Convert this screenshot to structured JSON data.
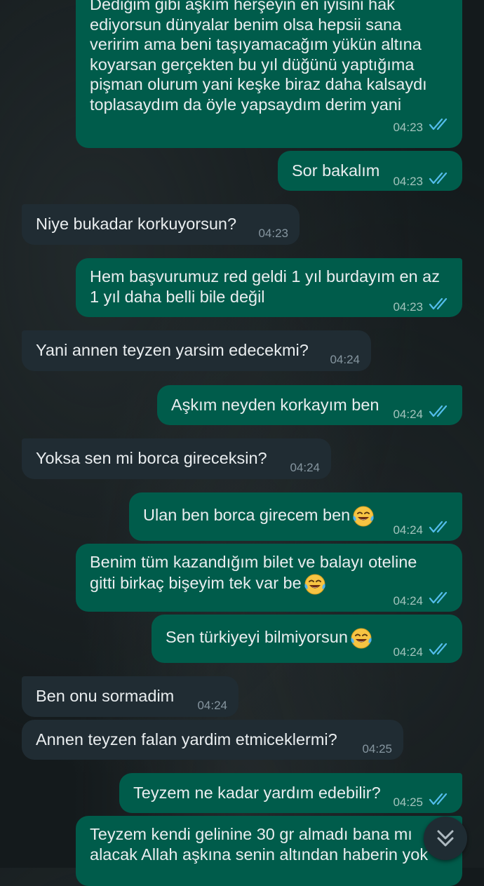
{
  "messages": [
    {
      "dir": "out",
      "text": "Dediğim gibi aşkım herşeyin en iyisini hak\nediyorsun dünyalar benim olsa hepsii sana\nveririm ama beni taşıyamacağım yükün altına\nkoyarsan gerçekten bu yıl düğünü yaptığıma\npişman olurum yani keşke biraz daha kalsaydı\ntoplasaydım da öyle yapsaydım derim yani",
      "time": "04:23",
      "read": true
    },
    {
      "dir": "out",
      "text": "Sor bakalım",
      "time": "04:23",
      "read": true
    },
    {
      "dir": "in",
      "text": "Niye bukadar korkuyorsun?",
      "time": "04:23"
    },
    {
      "dir": "out",
      "text": "Hem başvurumuz red geldi 1 yıl burdayım en az\n1 yıl daha belli bile değil",
      "time": "04:23",
      "read": true
    },
    {
      "dir": "in",
      "text": "Yani annen teyzen yarsim edecekmi?",
      "time": "04:24"
    },
    {
      "dir": "out",
      "text": "Aşkım neyden korkayım ben",
      "time": "04:24",
      "read": true
    },
    {
      "dir": "in",
      "text": "Yoksa sen mi borca gireceksin?",
      "time": "04:24"
    },
    {
      "dir": "out",
      "text": "Ulan ben borca girecem ben",
      "time": "04:24",
      "read": true,
      "emoji": "face-with-tears-of-joy"
    },
    {
      "dir": "out",
      "text": "Benim tüm kazandığım bilet ve balayı oteline\ngitti birkaç bişeyim tek var be",
      "time": "04:24",
      "read": true,
      "emoji": "face-with-tears-of-joy"
    },
    {
      "dir": "out",
      "text": "Sen türkiyeyi bilmiyorsun",
      "time": "04:24",
      "read": true,
      "emoji": "face-with-tears-of-joy"
    },
    {
      "dir": "in",
      "text": "Ben onu sormadim",
      "time": "04:24"
    },
    {
      "dir": "in",
      "text": "Annen teyzen falan yardim etmiceklermi?",
      "time": "04:25"
    },
    {
      "dir": "out",
      "text": "Teyzem ne kadar yardım edebilir?",
      "time": "04:25",
      "read": true
    },
    {
      "dir": "out",
      "text": "Teyzem kendi gelinine 30 gr almadı bana mı\nalacak Allah aşkına senin altından haberin yok"
    }
  ],
  "colors": {
    "outgoing_bubble": "#005c4b",
    "incoming_bubble": "#202c33",
    "read_ticks": "#53bdeb",
    "background": "#141a1c"
  },
  "scroll_button": {
    "icon": "double-chevron-down-icon"
  }
}
